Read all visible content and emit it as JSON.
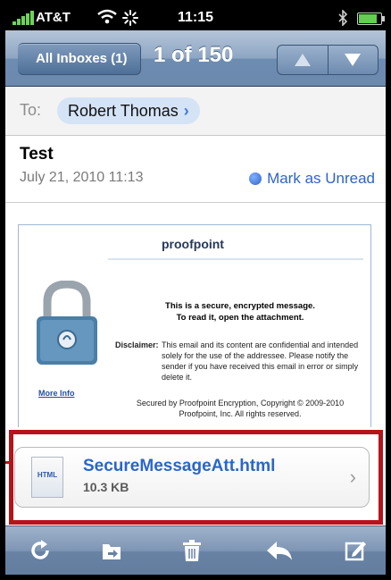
{
  "status_bar": {
    "carrier": "AT&T",
    "time": "11:15",
    "battery_level": 0.85
  },
  "nav": {
    "back_label": "All Inboxes (1)",
    "pager": "1 of 150",
    "up_icon": "up-arrow-icon",
    "down_icon": "down-arrow-icon"
  },
  "to_row": {
    "label": "To:",
    "recipient": "Robert Thomas",
    "chevron": "›"
  },
  "message": {
    "subject": "Test",
    "date": "July 21, 2010 11:13",
    "mark_unread": "Mark as Unread"
  },
  "body": {
    "brand": "proofpoint",
    "notice_line1": "This is a secure, encrypted message.",
    "notice_line2": "To read it, open the attachment.",
    "disclaimer_label": "Disclaimer:",
    "disclaimer_text": "This email and its content are confidential and intended solely for the use of the addressee. Please notify the sender if you have received this email in error or simply delete it.",
    "more_info": "More Info",
    "secured_line1": "Secured by Proofpoint Encryption, Copyright © 2009-2010",
    "secured_line2": "Proofpoint, Inc. All rights reserved."
  },
  "attachment": {
    "file_type": "HTML",
    "name": "SecureMessageAtt.html",
    "size": "10.3 KB",
    "chevron": "›"
  },
  "toolbar": {
    "icons": [
      "refresh-icon",
      "move-folder-icon",
      "trash-icon",
      "reply-icon",
      "compose-icon"
    ]
  },
  "colors": {
    "nav_blue": "#6d8cb1",
    "link_blue": "#2b66c8",
    "highlight_red": "#b5141a"
  }
}
